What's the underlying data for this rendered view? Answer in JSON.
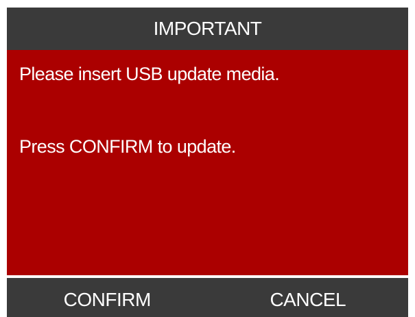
{
  "dialog": {
    "title": "IMPORTANT",
    "message_line_1": "Please insert USB update media.",
    "message_line_2": "Press CONFIRM to update."
  },
  "buttons": {
    "confirm_label": "CONFIRM",
    "cancel_label": "CANCEL"
  },
  "colors": {
    "title_bar_bg": "#3a3a3a",
    "message_bg": "#ab0000",
    "button_bar_bg": "#3a3a3a",
    "text": "#ffffff"
  }
}
